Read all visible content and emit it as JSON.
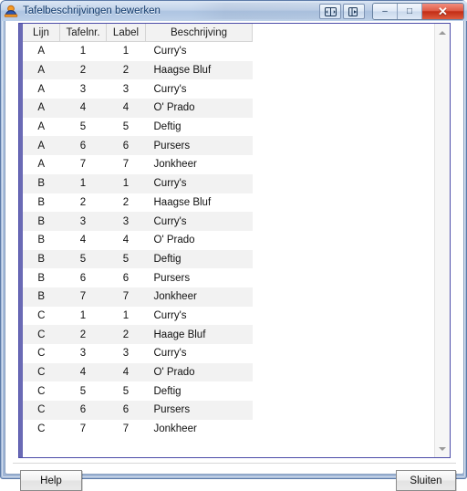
{
  "window": {
    "title": "Tafelbeschrijvingen bewerken",
    "app_icon": "app-icon",
    "controls": {
      "aux1": "split-view-icon",
      "aux2": "restore-window-icon",
      "minimize": "minimize-icon",
      "minimize_glyph": "–",
      "maximize": "maximize-icon",
      "maximize_glyph": "□",
      "close": "close-icon",
      "close_glyph": "✕"
    },
    "accent_titlebar": "#bdd0e8",
    "accent_close": "#c32d15",
    "accent_border": "#5d7ba8"
  },
  "grid": {
    "indicator_color": "#6a6ab5",
    "border_color": "#4c4ca8",
    "row_alt_color": "#f2f2f2",
    "columns": [
      "Lijn",
      "Tafelnr.",
      "Label",
      "Beschrijving"
    ],
    "rows": [
      [
        "A",
        "1",
        "1",
        "Curry's"
      ],
      [
        "A",
        "2",
        "2",
        "Haagse Bluf"
      ],
      [
        "A",
        "3",
        "3",
        "Curry's"
      ],
      [
        "A",
        "4",
        "4",
        "O' Prado"
      ],
      [
        "A",
        "5",
        "5",
        "Deftig"
      ],
      [
        "A",
        "6",
        "6",
        "Pursers"
      ],
      [
        "A",
        "7",
        "7",
        "Jonkheer"
      ],
      [
        "B",
        "1",
        "1",
        "Curry's"
      ],
      [
        "B",
        "2",
        "2",
        "Haagse Bluf"
      ],
      [
        "B",
        "3",
        "3",
        "Curry's"
      ],
      [
        "B",
        "4",
        "4",
        "O' Prado"
      ],
      [
        "B",
        "5",
        "5",
        "Deftig"
      ],
      [
        "B",
        "6",
        "6",
        "Pursers"
      ],
      [
        "B",
        "7",
        "7",
        "Jonkheer"
      ],
      [
        "C",
        "1",
        "1",
        "Curry's"
      ],
      [
        "C",
        "2",
        "2",
        "Haage Bluf"
      ],
      [
        "C",
        "3",
        "3",
        "Curry's"
      ],
      [
        "C",
        "4",
        "4",
        "O' Prado"
      ],
      [
        "C",
        "5",
        "5",
        "Deftig"
      ],
      [
        "C",
        "6",
        "6",
        "Pursers"
      ],
      [
        "C",
        "7",
        "7",
        "Jonkheer"
      ]
    ]
  },
  "scrollbar": {
    "up_arrow": "scroll-up-arrow-icon",
    "down_arrow": "scroll-down-arrow-icon"
  },
  "footer": {
    "help_label": "Help",
    "close_label": "Sluiten"
  }
}
